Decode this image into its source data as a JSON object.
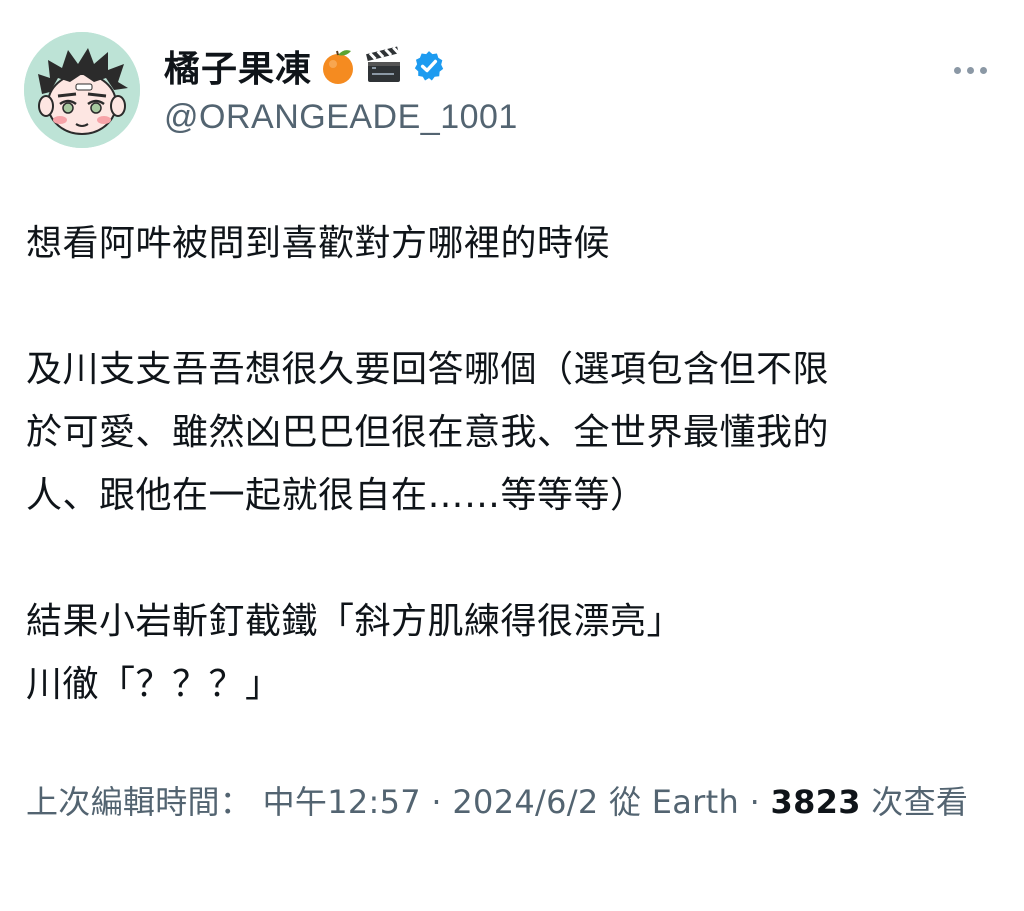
{
  "author": {
    "display_name": "橘子果凍",
    "handle": "@ORANGEADE_1001",
    "emojis": [
      "orange-emoji",
      "clapper-board-emoji"
    ],
    "verified": true,
    "verified_color": "#1d9bf0",
    "avatar_bg": "#bde3d6"
  },
  "more_icon": "more-horizontal-icon",
  "tweet": {
    "paragraphs": [
      "想看阿吽被問到喜歡對方哪裡的時候",
      "及川支支吾吾想很久要回答哪個（選項包含但不限\n於可愛、雖然凶巴巴但很在意我、全世界最懂我的\n人、跟他在一起就很自在……等等等）",
      "結果小岩斬釘截鐵「斜方肌練得很漂亮」\n川徹「？？？」"
    ]
  },
  "meta": {
    "edited_label": "上次編輯時間：",
    "time": "中午12:57",
    "separator": "·",
    "date": "2024/6/2",
    "source": "從 Earth",
    "views_count": "3823",
    "views_label": "次查看"
  }
}
